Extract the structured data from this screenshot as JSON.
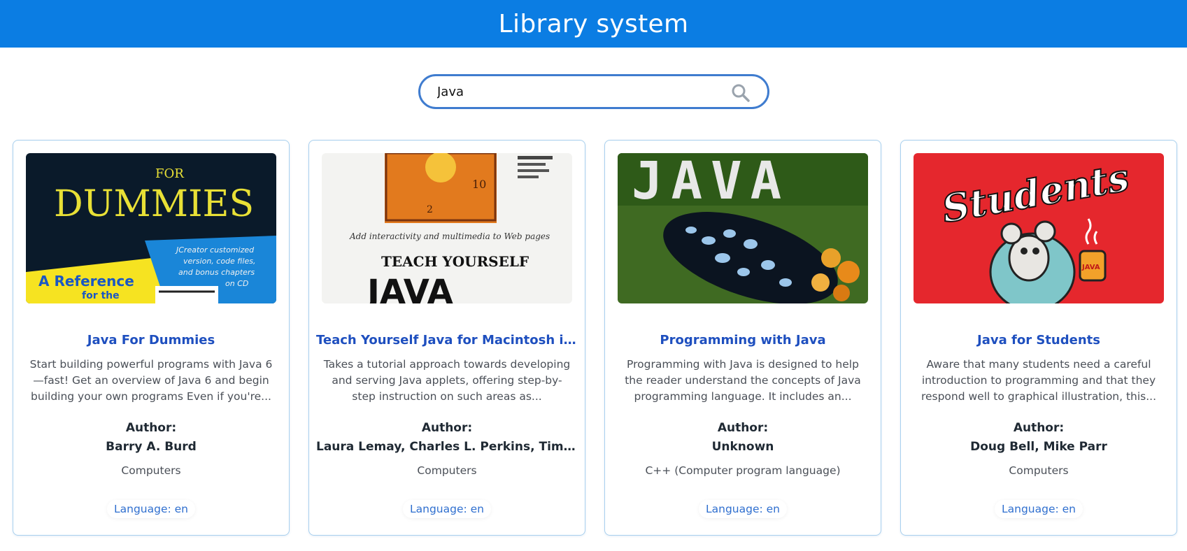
{
  "header": {
    "title": "Library system"
  },
  "search": {
    "value": "Java",
    "icon": "search-icon"
  },
  "colors": {
    "header_bg": "#0b7de3",
    "title_link": "#1e4fbf",
    "language": "#2f6fcf",
    "card_border": "#a9d0ee"
  },
  "books": [
    {
      "title": "Java For Dummies",
      "description": "Start building powerful programs with Java 6 —fast! Get an overview of Java 6 and begin building your own programs Even if you're...",
      "author_label": "Author:",
      "author": "Barry A. Burd",
      "category": "Computers",
      "language": "Language: en",
      "cover": {
        "lines": [
          "FOR",
          "DUMMIES",
          "JCreator customized",
          "version, code files,",
          "and bonus chapters",
          "on CD",
          "A Reference",
          "for the"
        ]
      }
    },
    {
      "title": "Teach Yourself Java for Macintosh in ...",
      "description": "Takes a tutorial approach towards developing and serving Java applets, offering step-by-step instruction on such areas as...",
      "author_label": "Author:",
      "author": "Laura Lemay, Charles L. Perkins, Tim ...",
      "category": "Computers",
      "language": "Language: en",
      "cover": {
        "lines": [
          "Add interactivity and multimedia to Web pages",
          "TEACH YOURSELF",
          "JAVA"
        ]
      }
    },
    {
      "title": "Programming with Java",
      "description": "Programming with Java is designed to help the reader understand the concepts of Java programming language. It includes an...",
      "author_label": "Author:",
      "author": "Unknown",
      "category": "C++ (Computer program language)",
      "language": "Language: en",
      "cover": {
        "lines": [
          "JAVA"
        ]
      }
    },
    {
      "title": "Java for Students",
      "description": "Aware that many students need a careful introduction to programming and that they respond well to graphical illustration, this...",
      "author_label": "Author:",
      "author": "Doug Bell, Mike Parr",
      "category": "Computers",
      "language": "Language: en",
      "cover": {
        "lines": [
          "Students",
          "JAVA"
        ]
      }
    }
  ]
}
